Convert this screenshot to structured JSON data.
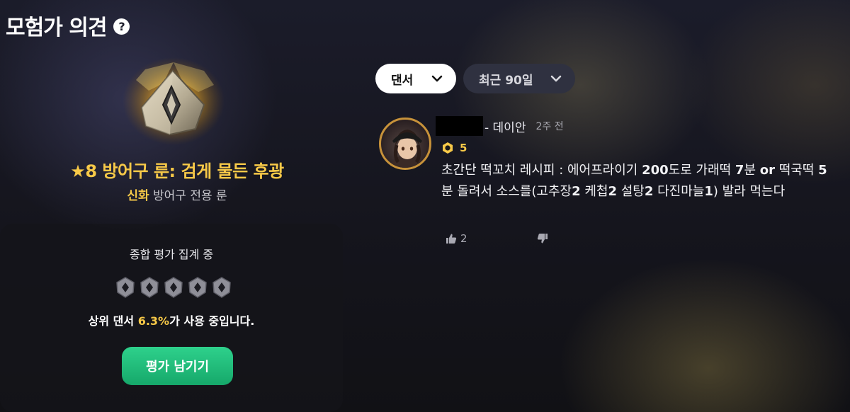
{
  "header": {
    "title": "모험가 의견",
    "help_icon": "question-circle-icon"
  },
  "rune": {
    "name": "★8 방어구 룬: 검게 물든 후광",
    "grade": "신화",
    "type": "방어구 전용 룬",
    "icon": "rune-gem-icon"
  },
  "summary": {
    "title": "종합 평가 집계 중",
    "rating_icons": 5,
    "usage_prefix": "상위 댄서 ",
    "usage_percent": "6.3%",
    "usage_suffix": "가 사용 중입니다.",
    "rate_button": "평가 남기기"
  },
  "filters": {
    "class_label": "댄서",
    "period_label": "최근 90일"
  },
  "comment": {
    "server": "- 데이안",
    "time": "2주 전",
    "level": "5",
    "body_segments": [
      {
        "t": "초간단 떡꼬치 레시피 : 에어프라이기 ",
        "b": false
      },
      {
        "t": "200",
        "b": true
      },
      {
        "t": "도로 가래떡 ",
        "b": false
      },
      {
        "t": "7",
        "b": true
      },
      {
        "t": "분 ",
        "b": false
      },
      {
        "t": "or",
        "b": true
      },
      {
        "t": " 떡국떡 ",
        "b": false
      },
      {
        "t": "5",
        "b": true
      },
      {
        "t": "분 돌려서 소스를(고추장",
        "b": false
      },
      {
        "t": "2",
        "b": true
      },
      {
        "t": " 케첩",
        "b": false
      },
      {
        "t": "2",
        "b": true
      },
      {
        "t": " 설탕",
        "b": false
      },
      {
        "t": "2",
        "b": true
      },
      {
        "t": " 다진마늘",
        "b": false
      },
      {
        "t": "1",
        "b": true
      },
      {
        "t": ") 발라 먹는다",
        "b": false
      }
    ],
    "likes": "2"
  },
  "colors": {
    "accent_gold": "#f7c948",
    "button_green": "#1fbf7a",
    "avatar_ring": "#c7923a"
  }
}
